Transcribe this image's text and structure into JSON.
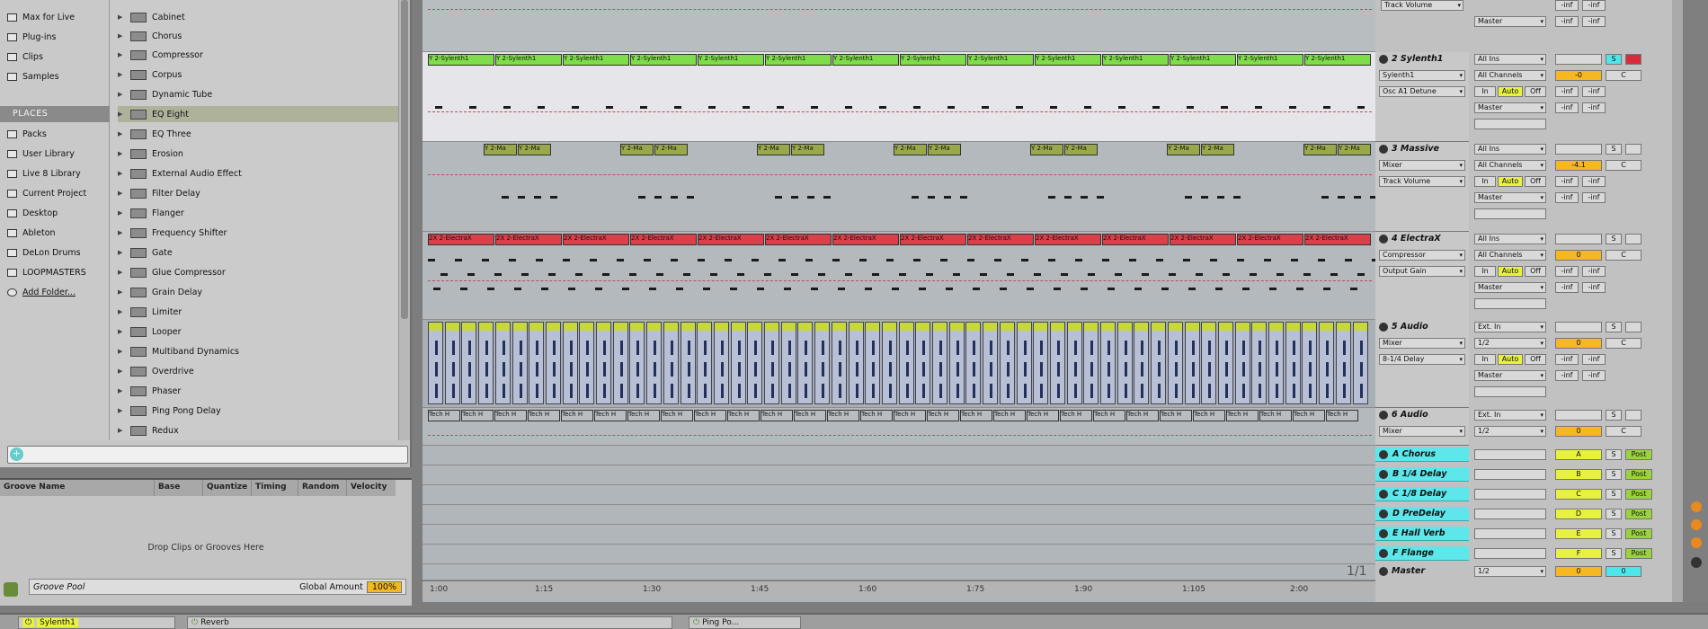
{
  "categories_top": [
    "Max for Live",
    "Plug-ins",
    "Clips",
    "Samples"
  ],
  "places_header": "PLACES",
  "places": [
    "Packs",
    "User Library",
    "Live 8 Library",
    "Current Project",
    "Desktop",
    "Ableton",
    "DeLon Drums",
    "LOOPMASTERS",
    "Add Folder..."
  ],
  "devices": [
    "Cabinet",
    "Chorus",
    "Compressor",
    "Corpus",
    "Dynamic Tube",
    "EQ Eight",
    "EQ Three",
    "Erosion",
    "External Audio Effect",
    "Filter Delay",
    "Flanger",
    "Frequency Shifter",
    "Gate",
    "Glue Compressor",
    "Grain Delay",
    "Limiter",
    "Looper",
    "Multiband Dynamics",
    "Overdrive",
    "Phaser",
    "Ping Pong Delay",
    "Redux"
  ],
  "selected_device": "EQ Eight",
  "groove": {
    "columns": [
      "Groove Name",
      "Base",
      "Quantize",
      "Timing",
      "Random",
      "Velocity"
    ],
    "drop_text": "Drop Clips or Grooves Here",
    "pool_label": "Groove Pool",
    "global_amount_label": "Global Amount",
    "global_amount_value": "100%"
  },
  "arrangement": {
    "clip_labels": {
      "sylenth": "Y 2-Sylenth1",
      "massive": "Y 2-Ma",
      "electrax": "2X 2-ElectraX",
      "audio6": "Tech H"
    },
    "timeline": [
      "1:00",
      "1:15",
      "1:30",
      "1:45",
      "1:60",
      "1:75",
      "1:90",
      "1:105",
      "2:00"
    ],
    "pager": "1/1",
    "top_track_param": "Track Volume"
  },
  "mixer": {
    "tracks": [
      {
        "name": "2 Sylenth1",
        "input": "All Ins",
        "device": "Sylenth1",
        "channel": "All Channels",
        "param": "Osc A1 Detune",
        "output": "Master",
        "vol": "-0",
        "pan": "C"
      },
      {
        "name": "3 Massive",
        "input": "All Ins",
        "device": "Mixer",
        "channel": "All Channels",
        "param": "Track Volume",
        "output": "Master",
        "vol": "-4.1",
        "pan": "C"
      },
      {
        "name": "4 ElectraX",
        "input": "All Ins",
        "device": "Compressor",
        "channel": "All Channels",
        "param": "Output Gain",
        "output": "Master",
        "vol": "0",
        "pan": "C"
      },
      {
        "name": "5 Audio",
        "input": "Ext. In",
        "device": "Mixer",
        "channel": "1/2",
        "param": "8-1/4 Delay",
        "output": "Master",
        "vol": "0",
        "pan": "C"
      },
      {
        "name": "6 Audio",
        "input": "Ext. In",
        "device": "Mixer",
        "channel": "1/2",
        "param": "",
        "output": "Master",
        "vol": "0",
        "pan": "C"
      }
    ],
    "returns": [
      {
        "name": "A Chorus",
        "letter": "A"
      },
      {
        "name": "B 1/4 Delay",
        "letter": "B"
      },
      {
        "name": "C 1/8 Delay",
        "letter": "C"
      },
      {
        "name": "D PreDelay",
        "letter": "D"
      },
      {
        "name": "E Hall Verb",
        "letter": "E"
      },
      {
        "name": "F Flange",
        "letter": "F"
      }
    ],
    "master": {
      "name": "Master",
      "output": "1/2",
      "vol": "0",
      "pan": "0"
    },
    "auto": "Auto",
    "in": "In",
    "off": "Off",
    "s": "S",
    "post": "Post",
    "inf": "-inf",
    "top_track_output": "Master"
  },
  "devbar": {
    "instrument": "Sylenth1",
    "effect1": "Reverb",
    "effect2": "Ping Po..."
  },
  "colors": {
    "green": "#7fdc4a",
    "red": "#d8404a",
    "olive": "#9aa84c",
    "cyan": "#5ee7ea",
    "orange": "#f5b820"
  }
}
